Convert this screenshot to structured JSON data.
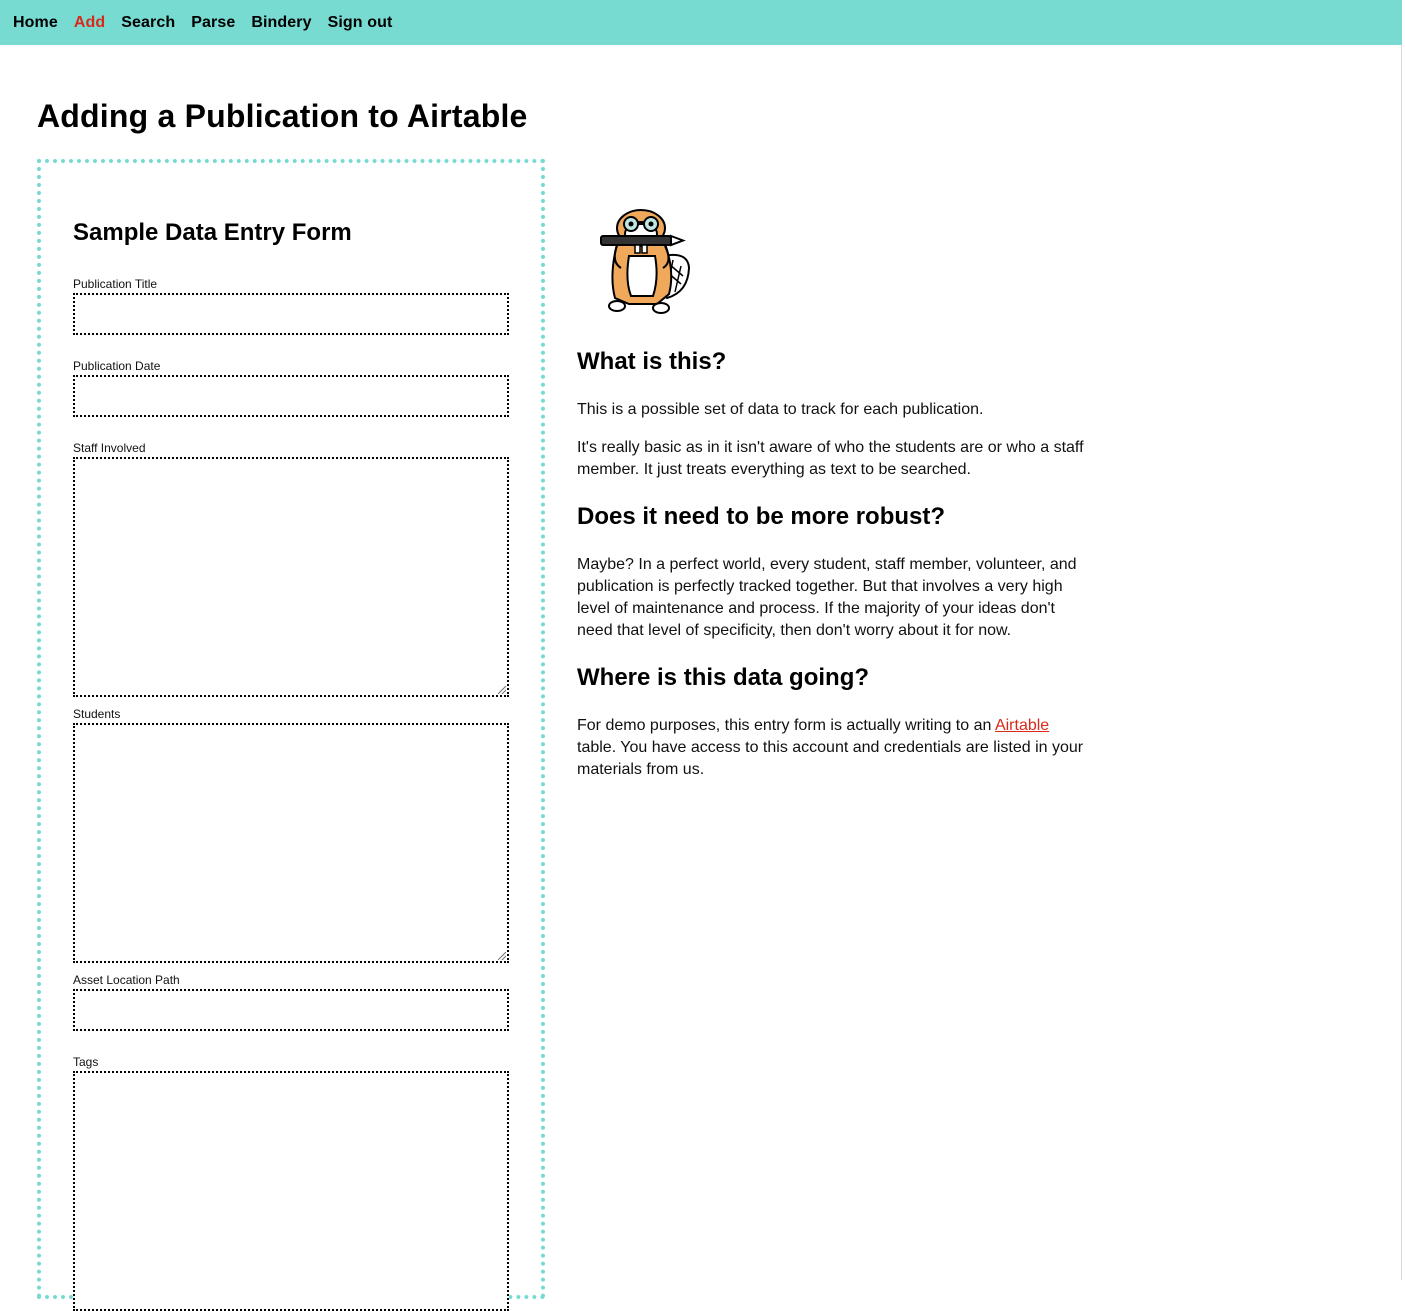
{
  "nav": {
    "items": [
      {
        "label": "Home"
      },
      {
        "label": "Add"
      },
      {
        "label": "Search"
      },
      {
        "label": "Parse"
      },
      {
        "label": "Bindery"
      },
      {
        "label": "Sign out"
      }
    ],
    "active": "Add"
  },
  "page": {
    "title": "Adding a Publication to Airtable"
  },
  "form": {
    "heading": "Sample Data Entry Form",
    "fields": {
      "publication_title": {
        "label": "Publication Title",
        "value": ""
      },
      "publication_date": {
        "label": "Publication Date",
        "value": ""
      },
      "staff_involved": {
        "label": "Staff Involved",
        "value": ""
      },
      "students": {
        "label": "Students",
        "value": ""
      },
      "asset_location_path": {
        "label": "Asset Location Path",
        "value": ""
      },
      "tags": {
        "label": "Tags",
        "value": ""
      }
    }
  },
  "info": {
    "mascot_icon": "beaver-mascot-icon",
    "sections": [
      {
        "heading": "What is this?",
        "paragraphs": [
          "This is a possible set of data to track for each publication.",
          "It's really basic as in it isn't aware of who the students are or who a staff member. It just treats everything as text to be searched."
        ]
      },
      {
        "heading": "Does it need to be more robust?",
        "paragraphs": [
          "Maybe? In a perfect world, every student, staff member, volunteer, and publication is perfectly tracked together. But that involves a very high level of maintenance and process. If the majority of your ideas don't need that level of specificity, then don't worry about it for now."
        ]
      },
      {
        "heading": "Where is this data going?",
        "paragraphs": [
          {
            "before": "For demo purposes, this entry form is actually writing to an ",
            "link": "Airtable",
            "after": " table. You have access to this account and credentials are listed in your materials from us."
          }
        ]
      }
    ]
  },
  "colors": {
    "nav_bg": "#77dbd2",
    "accent": "#d9291a",
    "panel_border": "#77dbd2"
  }
}
